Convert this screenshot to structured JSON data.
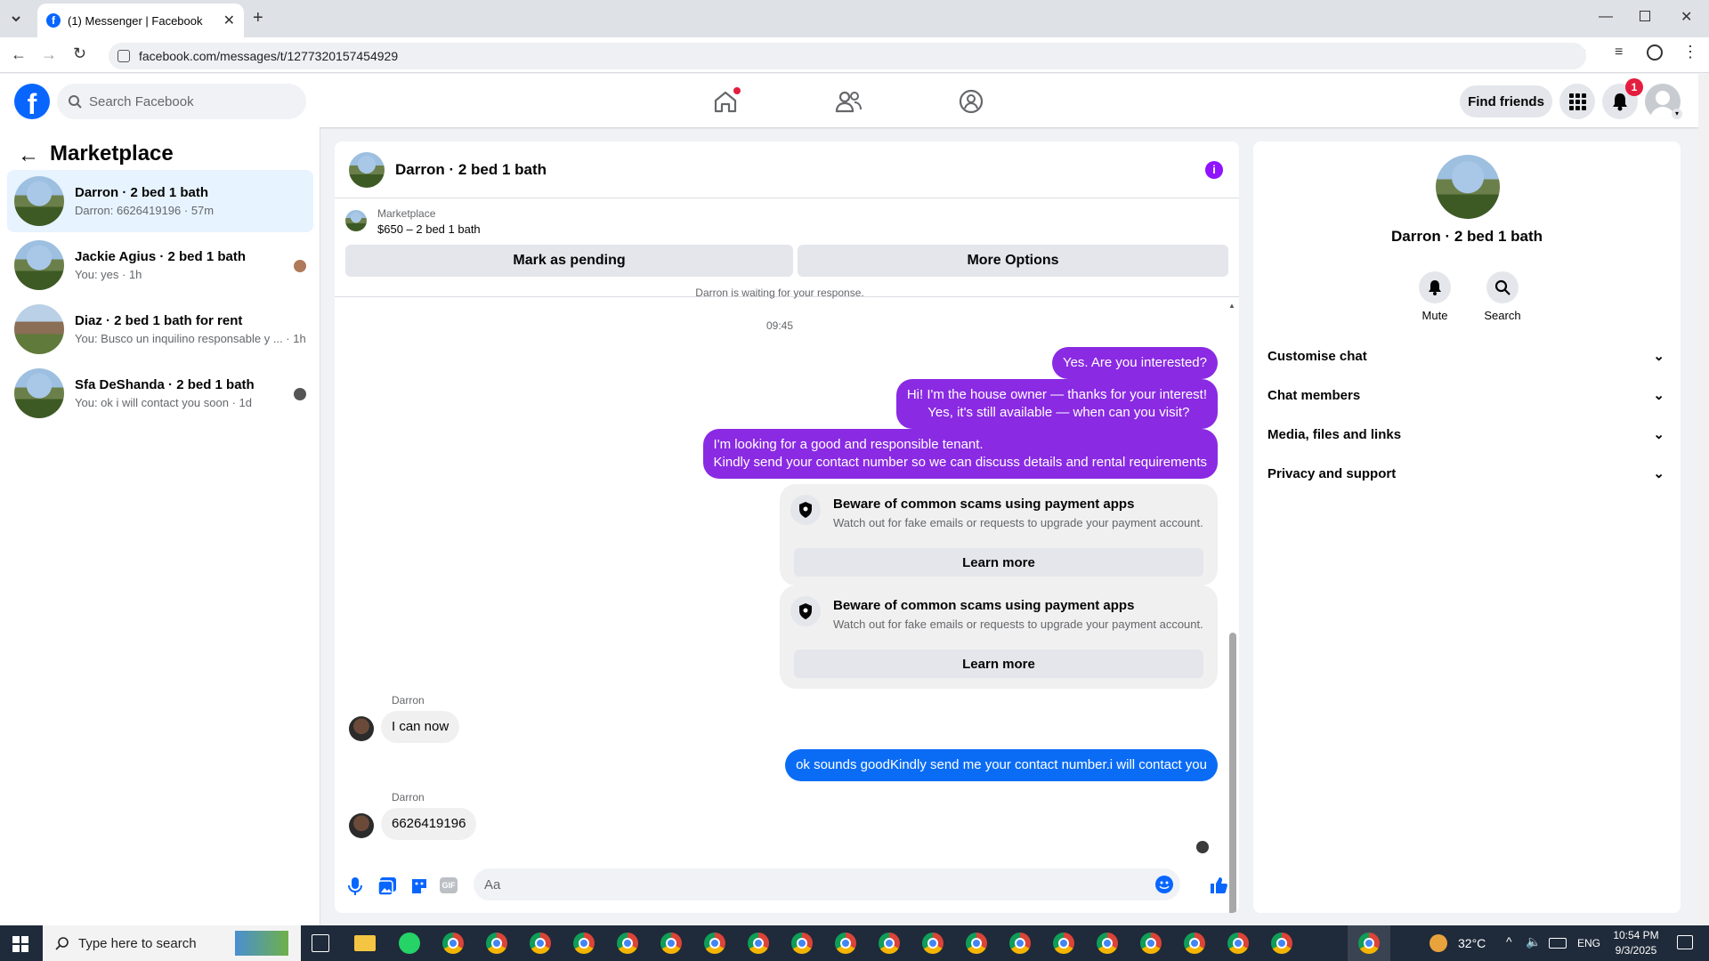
{
  "browser": {
    "tab_title": "(1) Messenger | Facebook",
    "url": "facebook.com/messages/t/1277320157454929"
  },
  "fb": {
    "search_placeholder": "Search Facebook",
    "find_friends": "Find friends",
    "notification_count": "1"
  },
  "sidebar": {
    "title": "Marketplace",
    "conversations": [
      {
        "name": "Darron · 2 bed 1 bath",
        "sub": "Darron: 6626419196 · 57m"
      },
      {
        "name": "Jackie Agius · 2 bed 1 bath",
        "sub": "You: yes · 1h"
      },
      {
        "name": "Diaz · 2 bed 1 bath for rent",
        "sub": "You: Busco un inquilino responsable y ... · 1h"
      },
      {
        "name": "Sfa DeShanda · 2 bed 1 bath",
        "sub": "You: ok i will contact you soon · 1d"
      }
    ]
  },
  "chat": {
    "header_title": "Darron · 2 bed 1 bath",
    "listing_label": "Marketplace",
    "listing_price": "$650 – 2 bed 1 bath",
    "mark_pending": "Mark as pending",
    "more_options": "More Options",
    "waiting_note": "Darron is waiting for your response.",
    "timestamp": "09:45",
    "msg1": "Yes. Are you interested?",
    "msg2": "Hi! I'm the house owner — thanks for your interest!\n Yes, it's still available — when can you visit?",
    "msg3": "I'm looking for a good and responsible tenant.\nKindly send your contact number so we can discuss details and rental requirements",
    "warn_title": "Beware of common scams using payment apps",
    "warn_desc": "Watch out for fake emails or requests to upgrade your payment account.",
    "learn_more": "Learn more",
    "sender": "Darron",
    "msg_in1": "I can now",
    "msg_out4": "ok sounds goodKindly send me your contact number.i will contact you",
    "msg_in2": "6626419196",
    "composer_placeholder": "Aa"
  },
  "right": {
    "title": "Darron · 2 bed 1 bath",
    "mute": "Mute",
    "search": "Search",
    "sections": [
      "Customise chat",
      "Chat members",
      "Media, files and links",
      "Privacy and support"
    ]
  },
  "taskbar": {
    "search_placeholder": "Type here to search",
    "temp": "32°C",
    "lang": "ENG",
    "time": "10:54 PM",
    "date": "9/3/2025"
  },
  "colors": {
    "fb_blue": "#0866ff",
    "purple_bubble": "#8a2ae3",
    "blue_bubble": "#0a6cf5",
    "notify_red": "#e41e3f"
  }
}
